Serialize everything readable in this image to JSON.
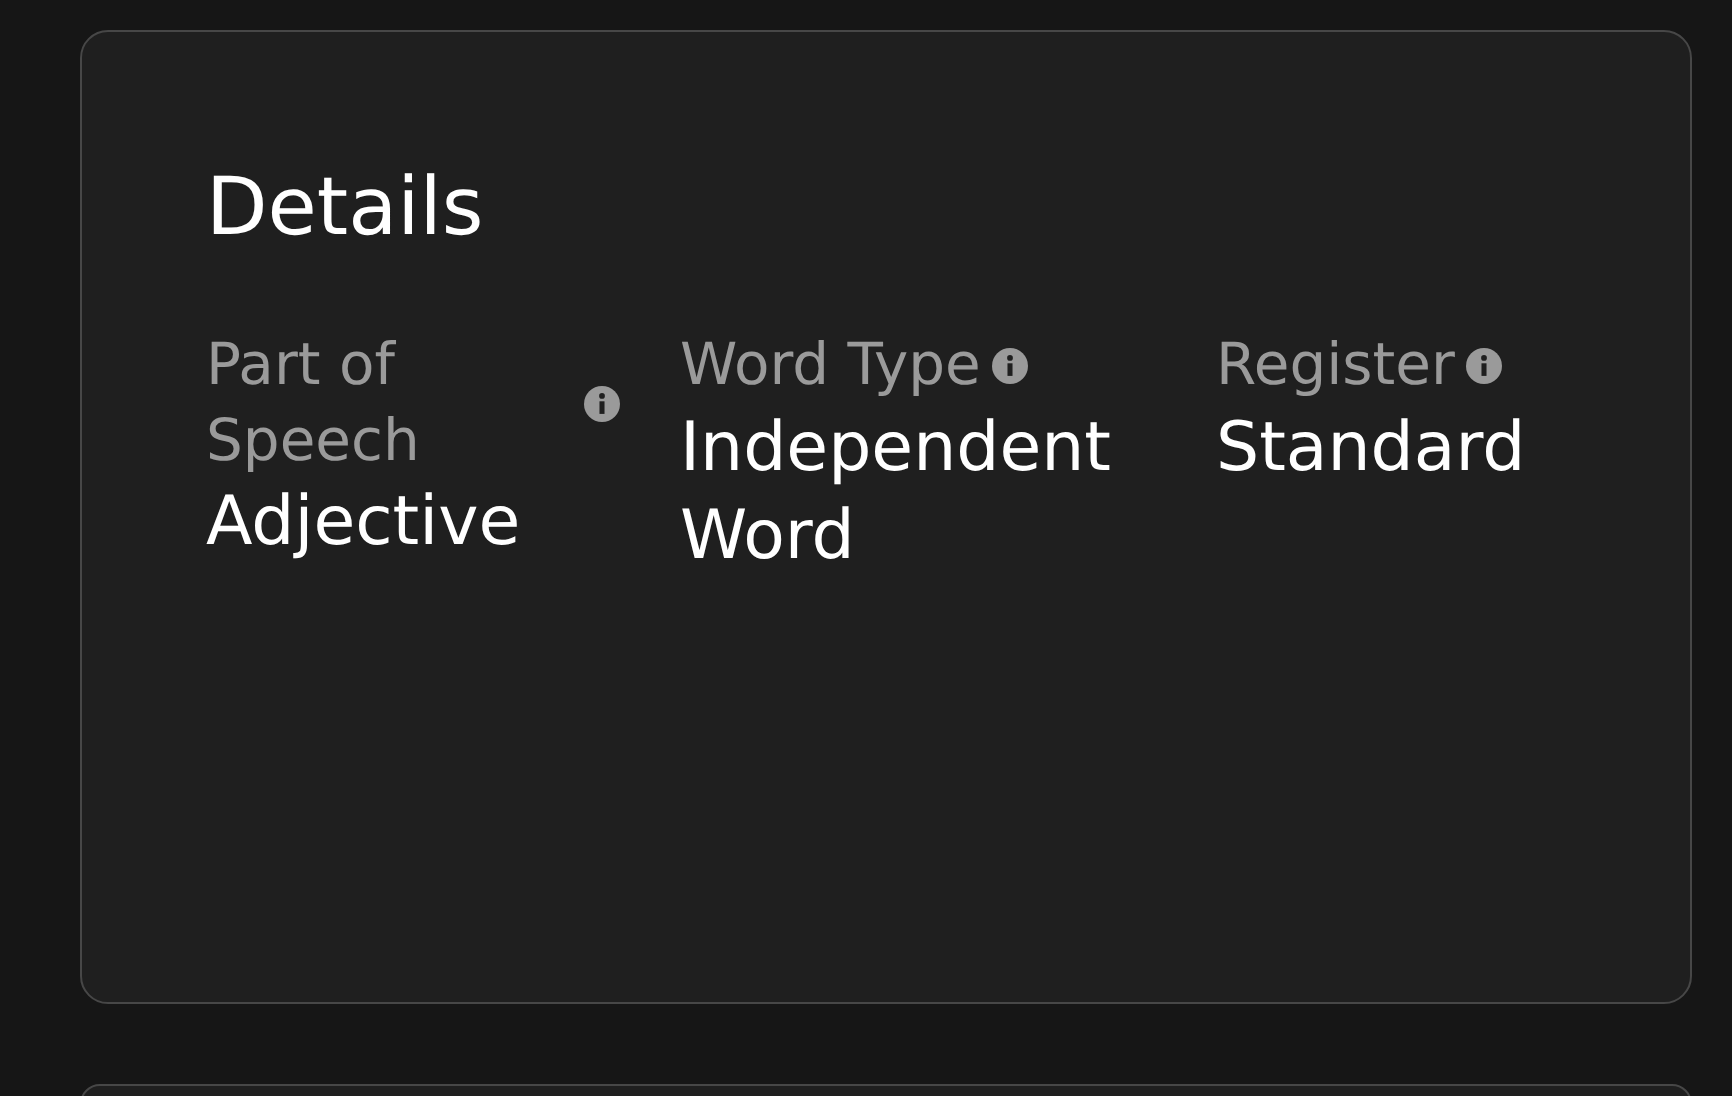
{
  "title": "Details",
  "fields": [
    {
      "label": "Part of Speech",
      "value": "Adjective"
    },
    {
      "label": "Word Type",
      "value": "Independent Word"
    },
    {
      "label": "Register",
      "value": "Standard"
    }
  ]
}
